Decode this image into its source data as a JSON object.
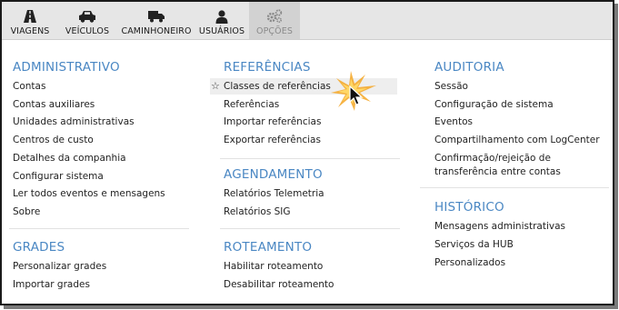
{
  "toolbar": {
    "items": [
      {
        "label": "VIAGENS",
        "icon": "road-icon"
      },
      {
        "label": "VEÍCULOS",
        "icon": "car-icon"
      },
      {
        "label": "CAMINHONEIRO",
        "icon": "truck-icon"
      },
      {
        "label": "USUÁRIOS",
        "icon": "user-icon"
      },
      {
        "label": "OPÇÕES",
        "icon": "gears-icon",
        "active": true
      }
    ]
  },
  "menu": {
    "administrativo": {
      "title": "ADMINISTRATIVO",
      "items": [
        "Contas",
        "Contas auxiliares",
        "Unidades administrativas",
        "Centros de custo",
        "Detalhes da companhia",
        "Configurar sistema",
        "Ler todos eventos e mensagens",
        "Sobre"
      ]
    },
    "grades": {
      "title": "GRADES",
      "items": [
        "Personalizar grades",
        "Importar grades"
      ]
    },
    "referencias": {
      "title": "REFERÊNCIAS",
      "items": [
        "Classes de referências",
        "Referências",
        "Importar referências",
        "Exportar referências"
      ]
    },
    "agendamento": {
      "title": "AGENDAMENTO",
      "items": [
        "Relatórios Telemetria",
        "Relatórios SIG"
      ]
    },
    "roteamento": {
      "title": "ROTEAMENTO",
      "items": [
        "Habilitar roteamento",
        "Desabilitar roteamento"
      ]
    },
    "auditoria": {
      "title": "AUDITORIA",
      "items": [
        "Sessão",
        "Configuração de sistema",
        "Eventos",
        "Compartilhamento com LogCenter",
        "Confirmação/rejeição de",
        "transferência entre contas"
      ]
    },
    "historico": {
      "title": "HISTÓRICO",
      "items": [
        "Mensagens administrativas",
        "Serviços da HUB",
        "Personalizados"
      ]
    }
  },
  "colors": {
    "section_title": "#4a87c3",
    "toolbar_bg": "#e6e6e6",
    "highlight": "#f5a623"
  }
}
